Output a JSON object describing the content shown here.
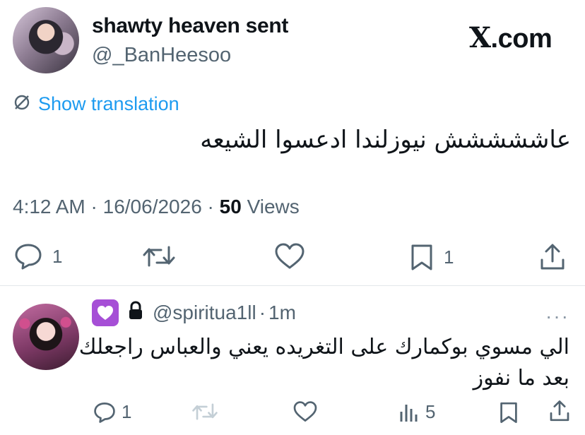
{
  "tweet": {
    "author": {
      "display_name": "shawty heaven sent",
      "handle": "@_BanHeesoo"
    },
    "brand": {
      "prefix": "X",
      "suffix": ".com"
    },
    "translation_label": "Show translation",
    "text": "عاششششش نيوزلندا ادعسوا الشيعه",
    "meta": {
      "time": "4:12 AM",
      "sep1": " · ",
      "date": "16/06/2026",
      "sep2": " · ",
      "views_count": "50",
      "views_label": " Views"
    },
    "actions": {
      "replies": "1",
      "bookmarks": "1"
    }
  },
  "reply": {
    "handle": "@spiritua1ll",
    "sep": "·",
    "time": "1m",
    "more": "···",
    "text_line1": "الي مسوي بوكمارك على التغريده يعني والعباس راجعلك",
    "text_line2": "بعد ما نفوز",
    "actions": {
      "replies": "1",
      "views": "5"
    }
  },
  "colors": {
    "accent": "#1d9bf0",
    "muted": "#536471",
    "heart_badge": "#a64fd6"
  }
}
